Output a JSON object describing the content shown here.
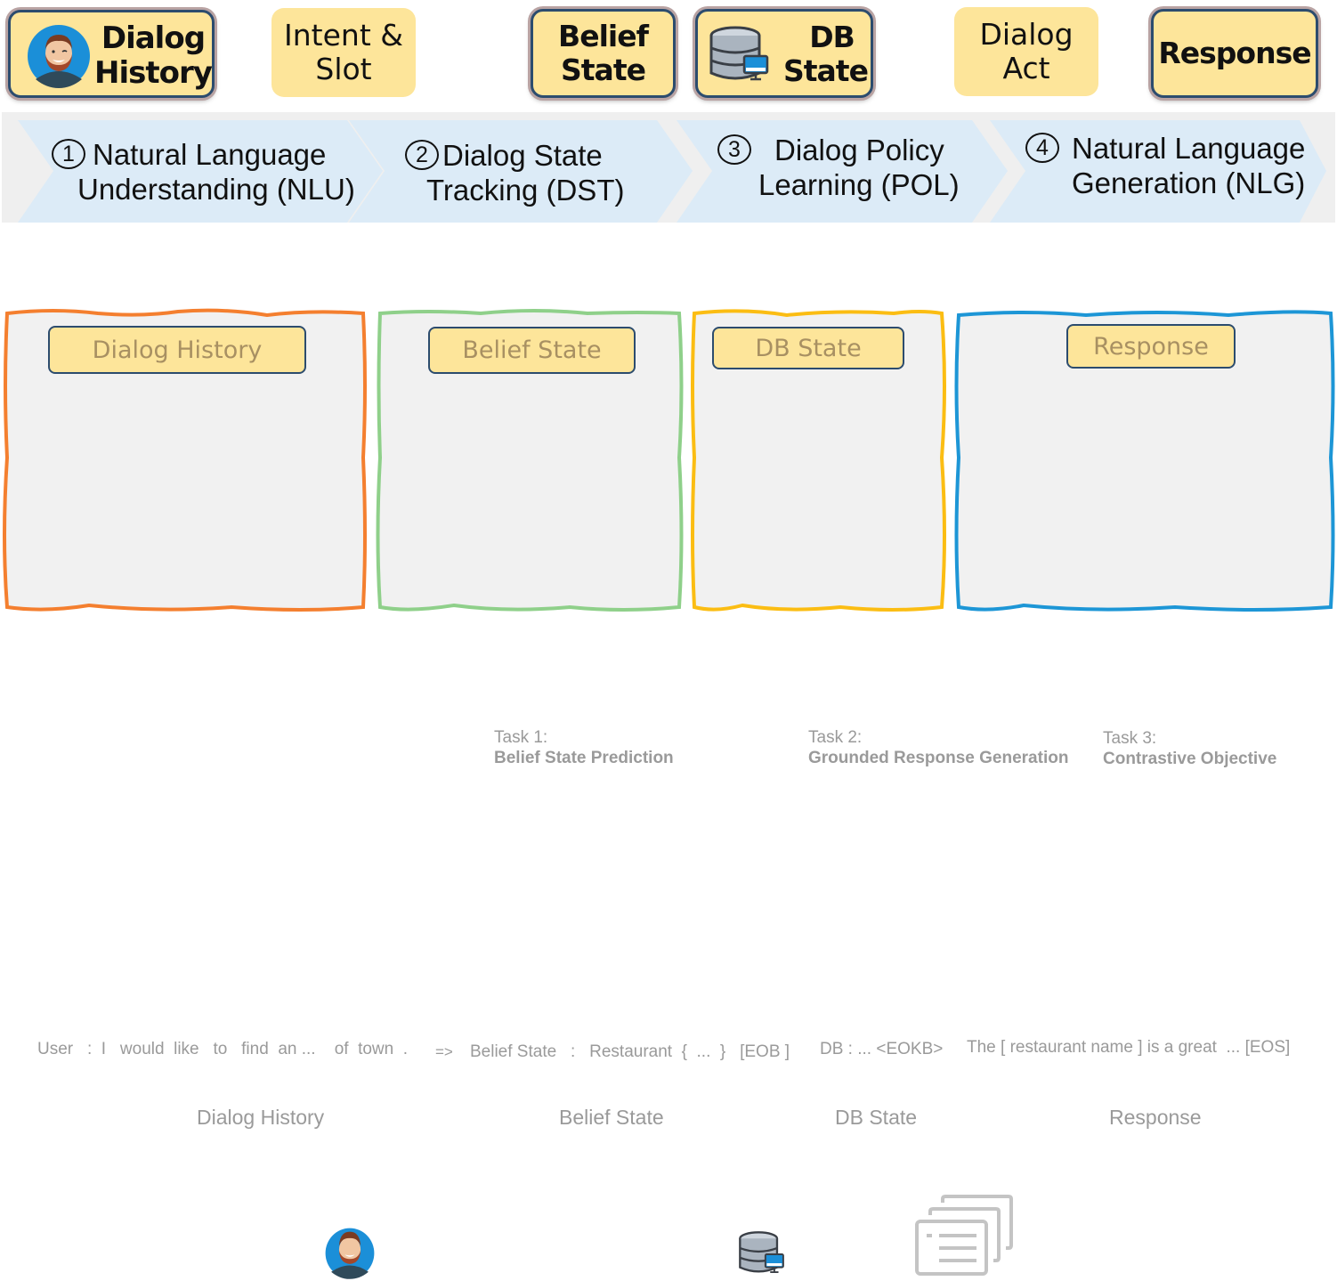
{
  "top_tags": [
    {
      "id": "dialog-history",
      "line1": "Dialog",
      "line2": "History",
      "style": "bold",
      "icon": "user-avatar-icon"
    },
    {
      "id": "intent-slot",
      "line1": "Intent &",
      "line2": "Slot",
      "style": "light"
    },
    {
      "id": "belief-state",
      "line1": "Belief",
      "line2": "State",
      "style": "bold"
    },
    {
      "id": "db-state",
      "line1": "DB",
      "line2": "State",
      "style": "bold",
      "icon": "database-icon"
    },
    {
      "id": "dialog-act",
      "line1": "Dialog",
      "line2": "Act",
      "style": "light"
    },
    {
      "id": "response",
      "line1": "Response",
      "line2": "",
      "style": "bold"
    }
  ],
  "pipeline": [
    {
      "num": "1",
      "line1": "Natural Language",
      "line2": "Understanding (NLU)"
    },
    {
      "num": "2",
      "line1": "Dialog State",
      "line2": "Tracking (DST)"
    },
    {
      "num": "3",
      "line1": "Dialog Policy",
      "line2": "Learning (POL)"
    },
    {
      "num": "4",
      "line1": "Natural Language",
      "line2": "Generation (NLG)"
    }
  ],
  "panels": [
    {
      "label": "Dialog History",
      "color": "#f47f2f"
    },
    {
      "label": "Belief State",
      "color": "#8fd08a"
    },
    {
      "label": "DB State",
      "color": "#fbbd13"
    },
    {
      "label": "Response",
      "color": "#1d96d6"
    }
  ],
  "tasks": [
    {
      "prefix": "Task 1:",
      "name": "Belief State Prediction"
    },
    {
      "prefix": "Task 2:",
      "name": "Grounded Response Generation"
    },
    {
      "prefix": "Task 3:",
      "name": "Contrastive Objective"
    }
  ],
  "sequence": {
    "history": "User   :  I   would  like   to   find  an ...    of  town  .",
    "arrow": "=>",
    "belief": "Belief State   :   Restaurant  {  ...  }   [EOB ]",
    "db": "DB : ... <EOKB>",
    "response": "The [ restaurant name ] is a great  ... [EOS]"
  },
  "segment_labels": [
    "Dialog History",
    "Belief State",
    "DB State",
    "Response"
  ],
  "colors": {
    "tag_fill": "#fde59a",
    "tag_border": "#2c4c6e",
    "chevron_fill": "#dcebf7",
    "band": "#efefef",
    "panel_fill": "#f1f1f1",
    "muted_text": "#9a9a9a"
  }
}
